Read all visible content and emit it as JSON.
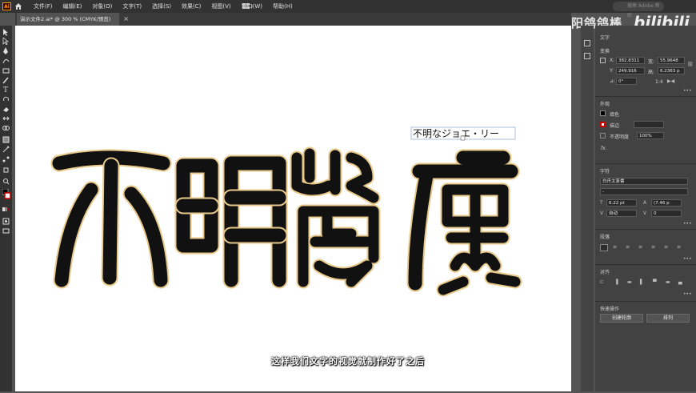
{
  "menubar": {
    "logo": "Ai",
    "menus": [
      "文件(F)",
      "编辑(E)",
      "对象(O)",
      "文字(T)",
      "选择(S)",
      "效果(C)",
      "视图(V)",
      "窗口(W)",
      "帮助(H)"
    ],
    "search_placeholder": "搜索 Adobe 帮助"
  },
  "watermark": {
    "channel": "大阳鸽鸽棒",
    "site": "bilibili"
  },
  "tab": {
    "label": "演示文件2.ai* @ 300 % (CMYK/预览)",
    "close": "×"
  },
  "canvas": {
    "small_label": "不明なジョエ・リー",
    "big_chars": [
      "不",
      "明",
      "鸞",
      "廣"
    ]
  },
  "properties": {
    "title": "文字",
    "transform": {
      "header": "变换",
      "x_label": "X:",
      "x_value": "382.8311",
      "y_label": "Y:",
      "y_value": "249.916",
      "w_label": "宽:",
      "w_value": "55.9648",
      "h_label": "高:",
      "h_value": "6.2363 p",
      "angle_label": "⊿:",
      "angle_value": "0°",
      "scale_label": "1:4"
    },
    "appearance": {
      "header": "外观",
      "fill_label": "填色",
      "stroke_label": "描边",
      "opacity_label": "不透明度",
      "opacity_value": "100%",
      "fx_label": "fx."
    },
    "character": {
      "header": "字符",
      "font_value": "白舟太篆書",
      "style_value": "-",
      "size_value": "6.22 pt",
      "leading_value": "(7.46 p",
      "kerning_value": "自动",
      "tracking_value": "0"
    },
    "paragraph": {
      "header": "段落"
    },
    "align": {
      "header": "对齐"
    },
    "quick_actions": {
      "header": "快速操作",
      "outline_button": "创建轮廓",
      "arrange_button": "排列"
    }
  },
  "subtitle": "这样我们文字的视觉就制作好了之后",
  "colors": {
    "outline": "#e8c98a",
    "glyph": "#111111",
    "canvas_bg": "#ffffff",
    "ui_dark": "#323232",
    "panel": "#424242"
  }
}
